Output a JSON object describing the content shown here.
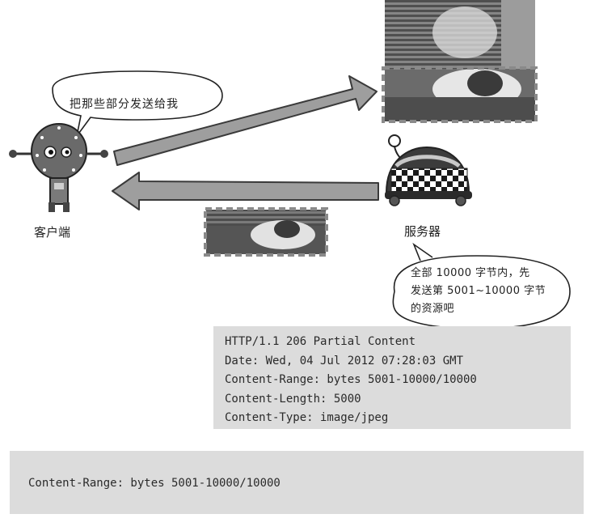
{
  "client": {
    "label": "客户端",
    "speech": "把那些部分发送给我"
  },
  "server": {
    "label": "服务器",
    "speech_lines": [
      "全部 10000 字节内，先",
      "发送第 5001~10000 字节",
      "的资源吧"
    ]
  },
  "response": {
    "lines": [
      "HTTP/1.1 206 Partial Content",
      "Date: Wed, 04 Jul 2012 07:28:03 GMT",
      "Content-Range: bytes 5001-10000/10000",
      "Content-Length: 5000",
      "Content-Type: image/jpeg"
    ]
  },
  "footer": {
    "header_line": "Content-Range: bytes 5001-10000/10000"
  },
  "colors": {
    "arrow": "#9e9e9e",
    "arrow_edge": "#3a3a3a",
    "box_bg": "#dcdcdc",
    "dash": "#8a8a8a"
  }
}
